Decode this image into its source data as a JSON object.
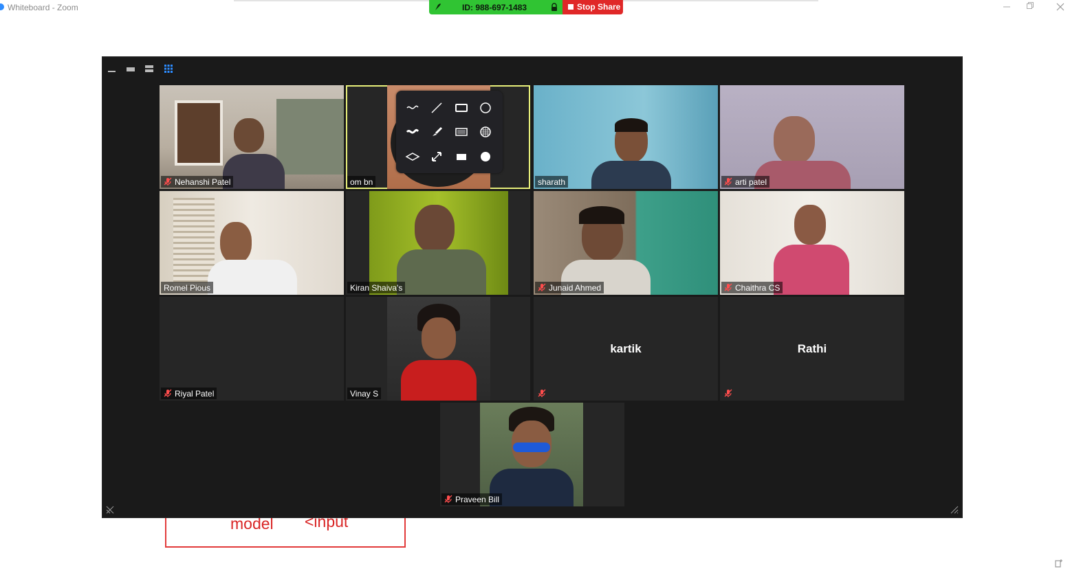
{
  "window": {
    "title": "Whiteboard - Zoom",
    "minimize_icon": "minimize-icon",
    "restore_icon": "restore-icon",
    "close_icon": "close-icon"
  },
  "share_toolbar": {
    "meeting_id": "ID: 988-697-1483",
    "stop_share_label": "Stop Share",
    "accent_green": "#30c433",
    "accent_red": "#e02828"
  },
  "gallery": {
    "view_modes": [
      "minimize-view-icon",
      "thumbnail-view-icon",
      "speaker-view-icon",
      "gallery-view-icon"
    ],
    "participants": [
      {
        "name": "Nehanshi Patel",
        "muted": true,
        "video": true
      },
      {
        "name": "om bn",
        "muted": false,
        "video": true,
        "active": true
      },
      {
        "name": "sharath",
        "muted": false,
        "video": true
      },
      {
        "name": "arti patel",
        "muted": true,
        "video": true
      },
      {
        "name": "Romel Pious",
        "muted": false,
        "video": true
      },
      {
        "name": "Kiran Shaiva's",
        "muted": false,
        "video": true
      },
      {
        "name": "Junaid Ahmed",
        "muted": true,
        "video": true
      },
      {
        "name": "Chaithra CS",
        "muted": true,
        "video": true
      },
      {
        "name": "Riyal Patel",
        "muted": true,
        "video": false
      },
      {
        "name": "Vinay S",
        "muted": false,
        "video": true
      },
      {
        "name": "kartik",
        "muted": true,
        "video": false,
        "display_name_only": true
      },
      {
        "name": "Rathi",
        "muted": true,
        "video": false,
        "display_name_only": true
      },
      {
        "name": "Praveen Bill",
        "muted": true,
        "video": true
      }
    ]
  },
  "annotation_tools": [
    "freehand-icon",
    "line-icon",
    "rectangle-icon",
    "ellipse-icon",
    "thick-freehand-icon",
    "brush-icon",
    "pattern-rectangle-icon",
    "grid-circle-icon",
    "diamond-icon",
    "double-arrow-icon",
    "filled-rectangle-icon",
    "filled-circle-icon"
  ],
  "whiteboard": {
    "text_model": "model",
    "text_input": "<input",
    "ink_color": "#d92525"
  }
}
